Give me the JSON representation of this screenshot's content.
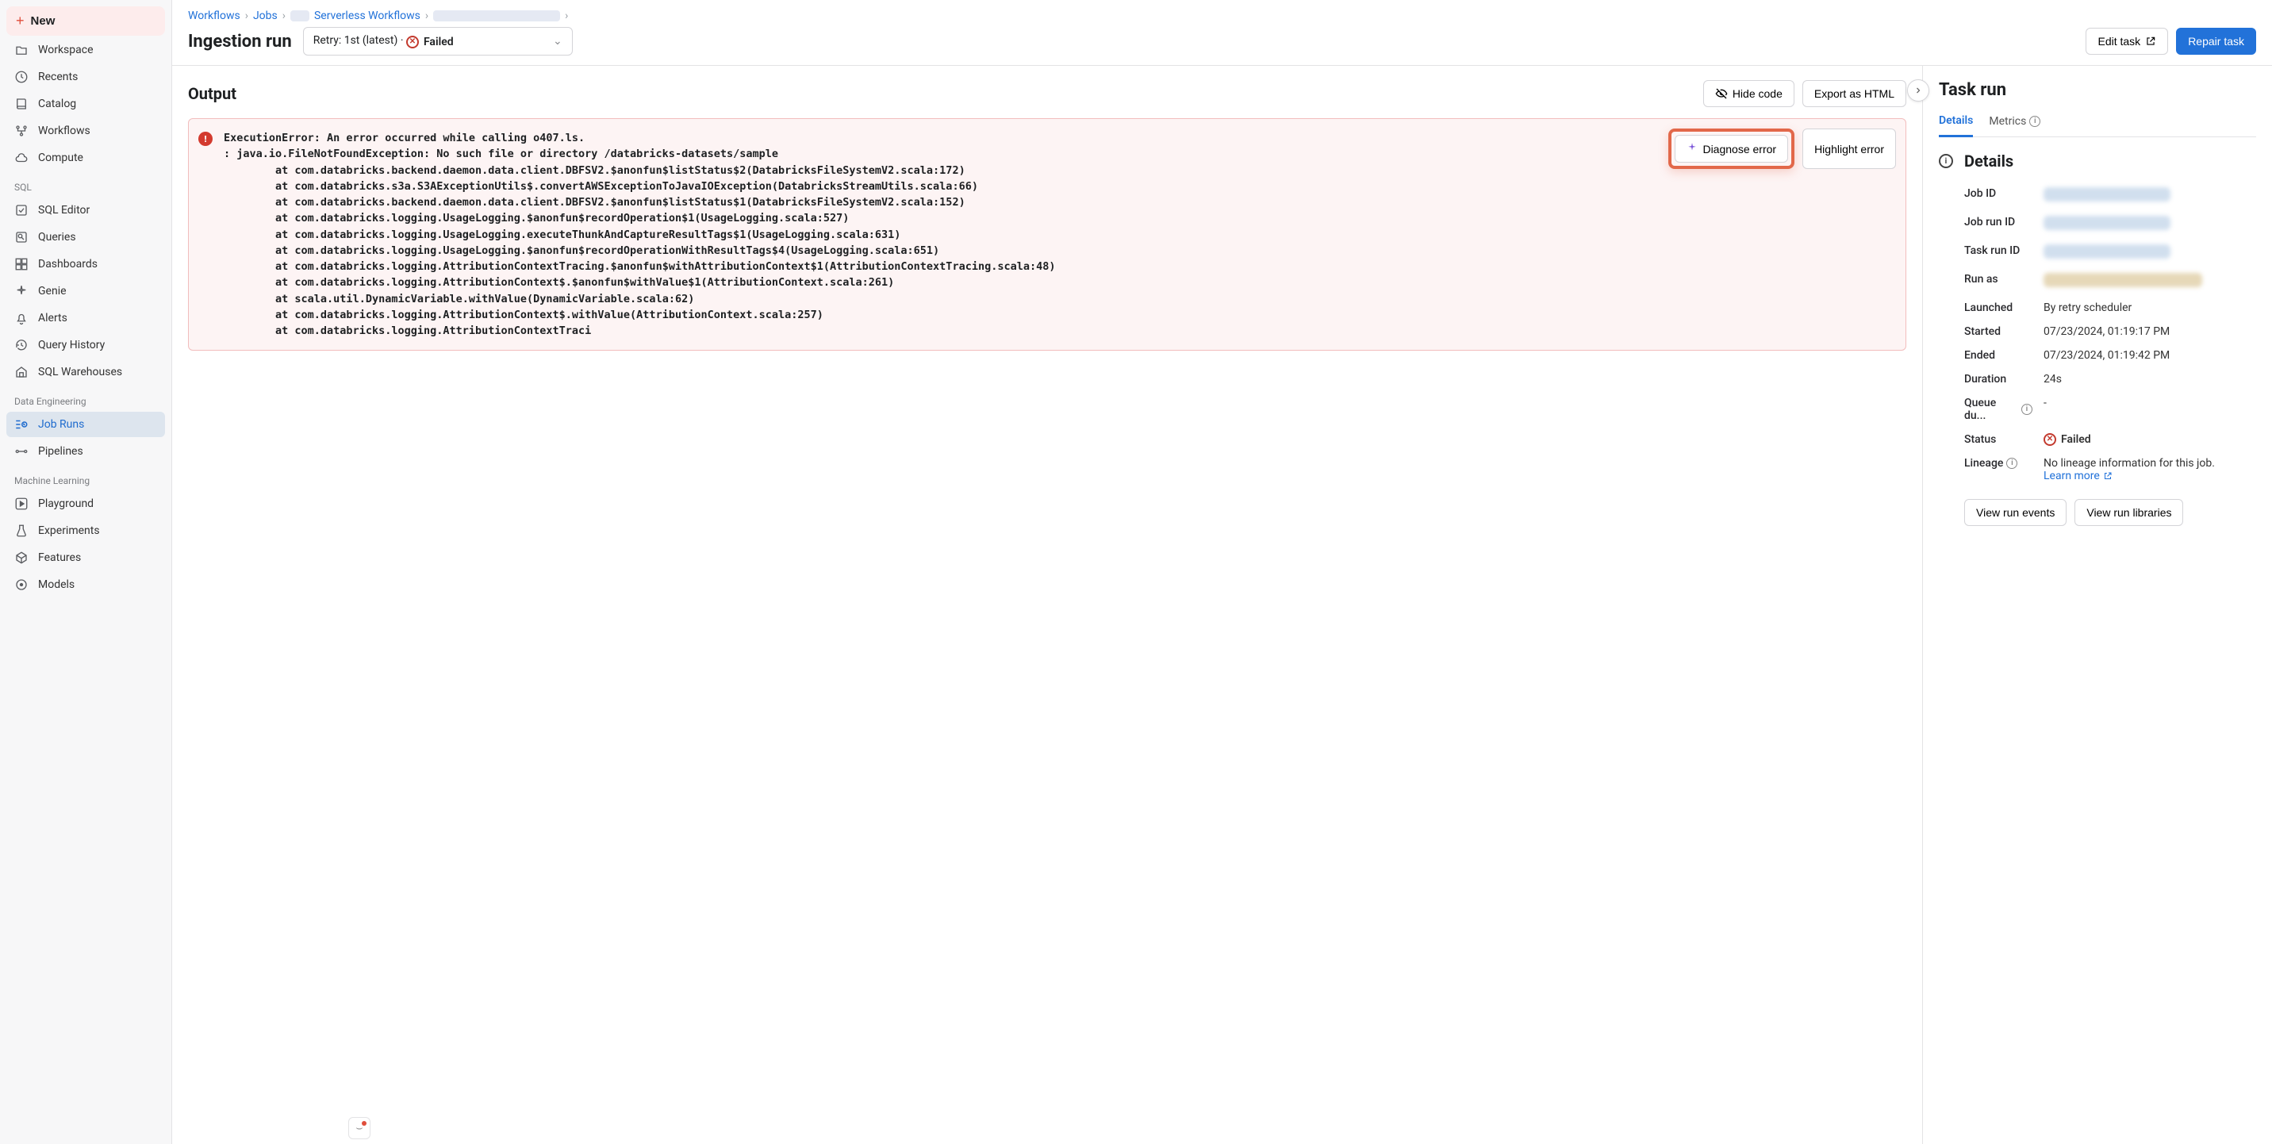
{
  "sidebar": {
    "new_label": "New",
    "nav": [
      {
        "icon": "folder",
        "label": "Workspace"
      },
      {
        "icon": "clock",
        "label": "Recents"
      },
      {
        "icon": "book",
        "label": "Catalog"
      },
      {
        "icon": "flow",
        "label": "Workflows"
      },
      {
        "icon": "cloud",
        "label": "Compute"
      }
    ],
    "section_sql": "SQL",
    "sql_nav": [
      {
        "icon": "editor",
        "label": "SQL Editor"
      },
      {
        "icon": "query",
        "label": "Queries"
      },
      {
        "icon": "dash",
        "label": "Dashboards"
      },
      {
        "icon": "genie",
        "label": "Genie"
      },
      {
        "icon": "bell",
        "label": "Alerts"
      },
      {
        "icon": "history",
        "label": "Query History"
      },
      {
        "icon": "warehouse",
        "label": "SQL Warehouses"
      }
    ],
    "section_de": "Data Engineering",
    "de_nav": [
      {
        "icon": "runs",
        "label": "Job Runs",
        "active": true
      },
      {
        "icon": "pipeline",
        "label": "Pipelines"
      }
    ],
    "section_ml": "Machine Learning",
    "ml_nav": [
      {
        "icon": "play",
        "label": "Playground"
      },
      {
        "icon": "beaker",
        "label": "Experiments"
      },
      {
        "icon": "box",
        "label": "Features"
      },
      {
        "icon": "model",
        "label": "Models"
      }
    ]
  },
  "breadcrumb": {
    "workflows": "Workflows",
    "jobs": "Jobs",
    "serverless": "Serverless Workflows"
  },
  "page_title": "Ingestion run",
  "retry_label": "Retry: 1st (latest) ·",
  "failed_text": "Failed",
  "edit_task": "Edit task",
  "repair_task": "Repair task",
  "output": {
    "title": "Output",
    "hide_code": "Hide code",
    "export_html": "Export as HTML",
    "diagnose": "Diagnose error",
    "highlight": "Highlight error",
    "error_text": "ExecutionError: An error occurred while calling o407.ls.\n: java.io.FileNotFoundException: No such file or directory /databricks-datasets/sample\n        at com.databricks.backend.daemon.data.client.DBFSV2.$anonfun$listStatus$2(DatabricksFileSystemV2.scala:172)\n        at com.databricks.s3a.S3AExceptionUtils$.convertAWSExceptionToJavaIOException(DatabricksStreamUtils.scala:66)\n        at com.databricks.backend.daemon.data.client.DBFSV2.$anonfun$listStatus$1(DatabricksFileSystemV2.scala:152)\n        at com.databricks.logging.UsageLogging.$anonfun$recordOperation$1(UsageLogging.scala:527)\n        at com.databricks.logging.UsageLogging.executeThunkAndCaptureResultTags$1(UsageLogging.scala:631)\n        at com.databricks.logging.UsageLogging.$anonfun$recordOperationWithResultTags$4(UsageLogging.scala:651)\n        at com.databricks.logging.AttributionContextTracing.$anonfun$withAttributionContext$1(AttributionContextTracing.scala:48)\n        at com.databricks.logging.AttributionContext$.$anonfun$withValue$1(AttributionContext.scala:261)\n        at scala.util.DynamicVariable.withValue(DynamicVariable.scala:62)\n        at com.databricks.logging.AttributionContext$.withValue(AttributionContext.scala:257)\n        at com.databricks.logging.AttributionContextTraci"
  },
  "taskrun": {
    "title": "Task run",
    "tab_details": "Details",
    "tab_metrics": "Metrics",
    "details_heading": "Details",
    "fields": {
      "job_id_label": "Job ID",
      "job_run_id_label": "Job run ID",
      "task_run_id_label": "Task run ID",
      "run_as_label": "Run as",
      "launched_label": "Launched",
      "launched_value": "By retry scheduler",
      "started_label": "Started",
      "started_value": "07/23/2024, 01:19:17 PM",
      "ended_label": "Ended",
      "ended_value": "07/23/2024, 01:19:42 PM",
      "duration_label": "Duration",
      "duration_value": "24s",
      "queue_label": "Queue du...",
      "queue_value": "-",
      "status_label": "Status",
      "status_value": "Failed",
      "lineage_label": "Lineage",
      "lineage_value": "No lineage information for this job.",
      "learn_more": "Learn more"
    },
    "view_events": "View run events",
    "view_libraries": "View run libraries"
  }
}
